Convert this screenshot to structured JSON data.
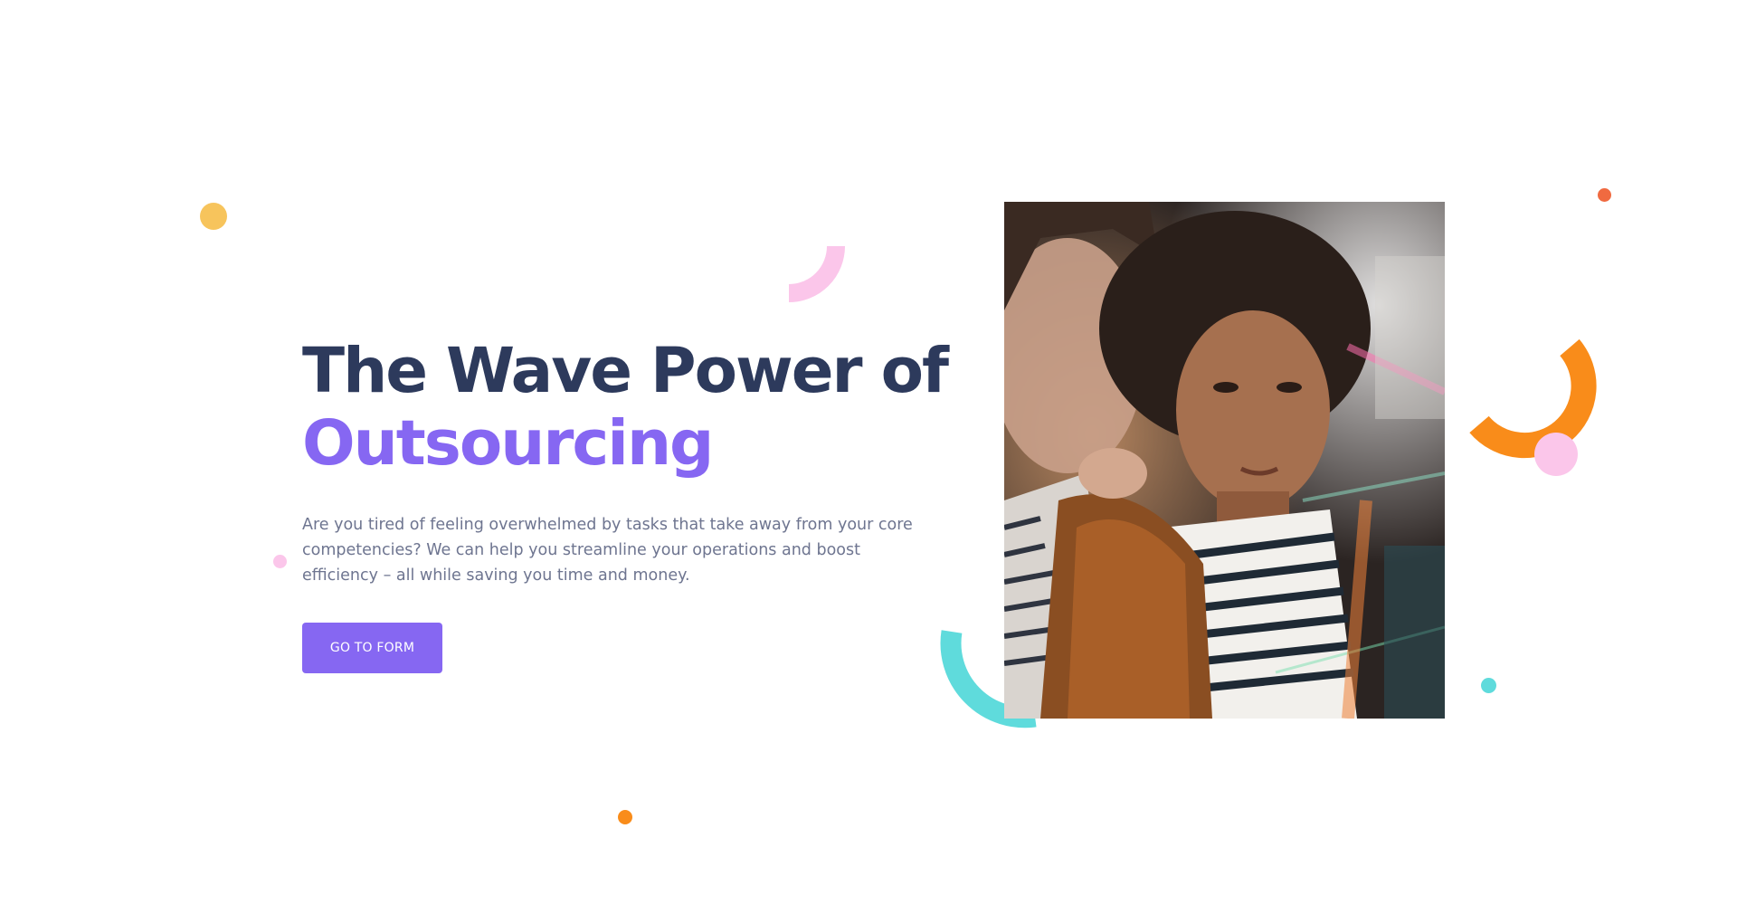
{
  "hero": {
    "headline_line1": "The Wave Power of",
    "headline_line2": "Outsourcing",
    "description": "Are you tired of feeling overwhelmed by tasks that take away from your core competencies? We can help you streamline your operations and boost efficiency – all while saving you time and money.",
    "cta_label": "GO TO FORM"
  },
  "colors": {
    "headline": "#2d3a5c",
    "accent_purple": "#8667f2",
    "body_text": "#6e7590",
    "yellow": "#f7c45c",
    "pink": "#fbc6ea",
    "orange": "#f98c1a",
    "teal": "#5fdbdc",
    "red_orange": "#f06a40"
  },
  "icons": {
    "photo": "photo-image-icon"
  }
}
